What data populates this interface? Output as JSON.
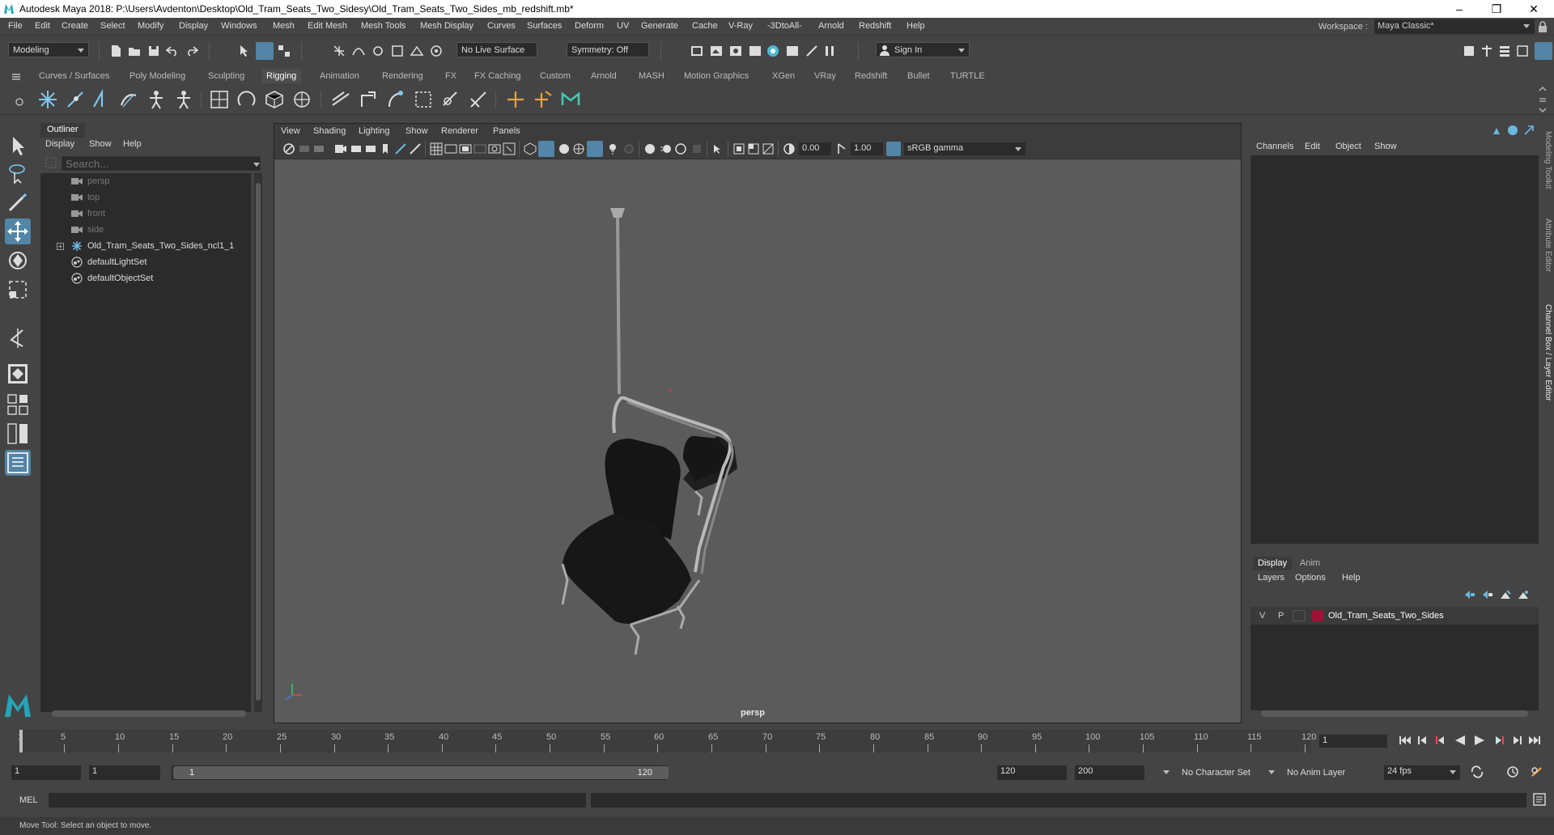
{
  "window": {
    "title": "Autodesk Maya 2018: P:\\Users\\Avdenton\\Desktop\\Old_Tram_Seats_Two_Sidesy\\Old_Tram_Seats_Two_Sides_mb_redshift.mb*",
    "minimize": "‒",
    "maximize": "❐",
    "close": "✕"
  },
  "menubar": {
    "items": [
      "File",
      "Edit",
      "Create",
      "Select",
      "Modify",
      "Display",
      "Windows",
      "Mesh",
      "Edit Mesh",
      "Mesh Tools",
      "Mesh Display",
      "Curves",
      "Surfaces",
      "Deform",
      "UV",
      "Generate",
      "Cache",
      "V-Ray",
      "-3DtoAll-",
      "Arnold",
      "Redshift",
      "Help"
    ],
    "workspace_label": "Workspace :",
    "workspace_value": "Maya Classic*"
  },
  "statusline": {
    "menuset": "Modeling",
    "live_surface": "No Live Surface",
    "symmetry": "Symmetry: Off",
    "sign_in": "Sign In"
  },
  "shelf": {
    "tabs": [
      "Curves / Surfaces",
      "Poly Modeling",
      "Sculpting",
      "Rigging",
      "Animation",
      "Rendering",
      "FX",
      "FX Caching",
      "Custom",
      "Arnold",
      "MASH",
      "Motion Graphics",
      "XGen",
      "VRay",
      "Redshift",
      "Bullet",
      "TURTLE"
    ],
    "active_tab": "Rigging"
  },
  "outliner": {
    "title": "Outliner",
    "menu": [
      "Display",
      "Show",
      "Help"
    ],
    "search_placeholder": "Search...",
    "items": [
      {
        "label": "persp",
        "type": "camera"
      },
      {
        "label": "top",
        "type": "camera"
      },
      {
        "label": "front",
        "type": "camera"
      },
      {
        "label": "side",
        "type": "camera"
      },
      {
        "label": "Old_Tram_Seats_Two_Sides_ncl1_1",
        "type": "group"
      },
      {
        "label": "defaultLightSet",
        "type": "set"
      },
      {
        "label": "defaultObjectSet",
        "type": "set"
      }
    ]
  },
  "viewport": {
    "menu": [
      "View",
      "Shading",
      "Lighting",
      "Show",
      "Renderer",
      "Panels"
    ],
    "exposure": "0.00",
    "gamma": "1.00",
    "colorspace": "sRGB gamma",
    "camera": "persp"
  },
  "channelbox": {
    "menu": [
      "Channels",
      "Edit",
      "Object",
      "Show"
    ],
    "layer_tabs": [
      "Display",
      "Anim"
    ],
    "layer_menu": [
      "Layers",
      "Options",
      "Help"
    ],
    "layer": {
      "v": "V",
      "p": "P",
      "name": "Old_Tram_Seats_Two_Sides",
      "color": "#9e1238"
    }
  },
  "sidetabs": [
    "Modeling Toolkit",
    "Attribute Editor",
    "Channel Box / Layer Editor"
  ],
  "timeslider": {
    "ticks": [
      "1",
      "5",
      "10",
      "15",
      "20",
      "25",
      "30",
      "35",
      "40",
      "45",
      "50",
      "55",
      "60",
      "65",
      "70",
      "75",
      "80",
      "85",
      "90",
      "95",
      "100",
      "105",
      "110",
      "115",
      "120"
    ],
    "current_frame": "1"
  },
  "range": {
    "start": "1",
    "playback_start": "1",
    "slider_start": "1",
    "slider_end": "120",
    "playback_end": "120",
    "end": "200",
    "character_set": "No Character Set",
    "anim_layer": "No Anim Layer",
    "fps": "24 fps"
  },
  "cmdline": {
    "label": "MEL"
  },
  "helpline": {
    "text": "Move Tool: Select an object to move."
  }
}
